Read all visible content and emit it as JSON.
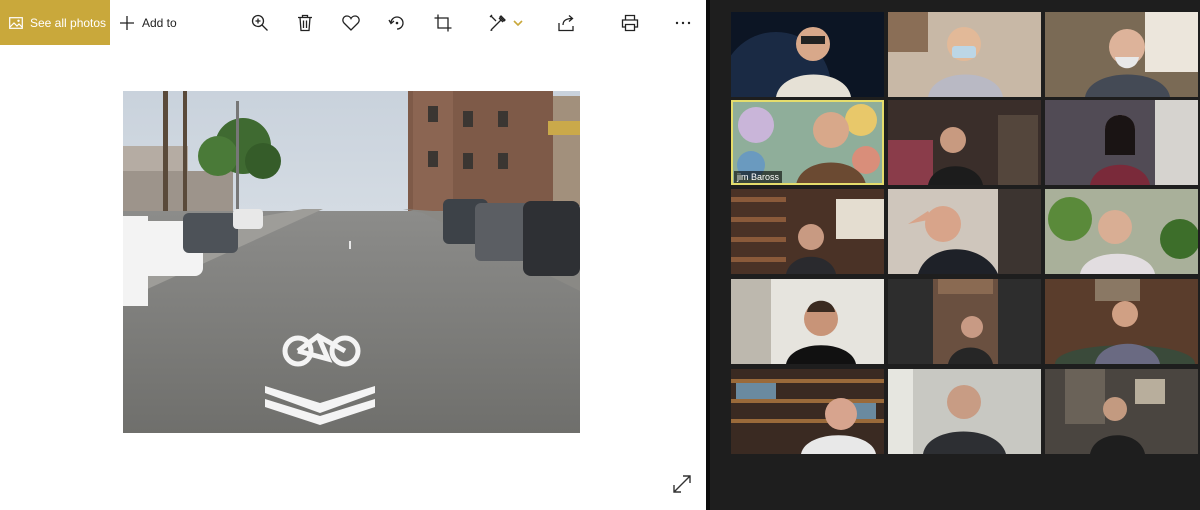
{
  "photos_app": {
    "see_all_label": "See all photos",
    "add_to_label": "Add to",
    "toolbar_icons": [
      "zoom-in-icon",
      "delete-icon",
      "heart-icon",
      "rotate-icon",
      "crop-icon",
      "edit-icon",
      "share-icon",
      "print-icon",
      "more-icon"
    ],
    "accent_color": "#c9a83b"
  },
  "zoom": {
    "active_speaker": "jim Baross",
    "highlight_color": "#e5dd6c",
    "grid_columns": 3,
    "grid_rows": 5
  }
}
